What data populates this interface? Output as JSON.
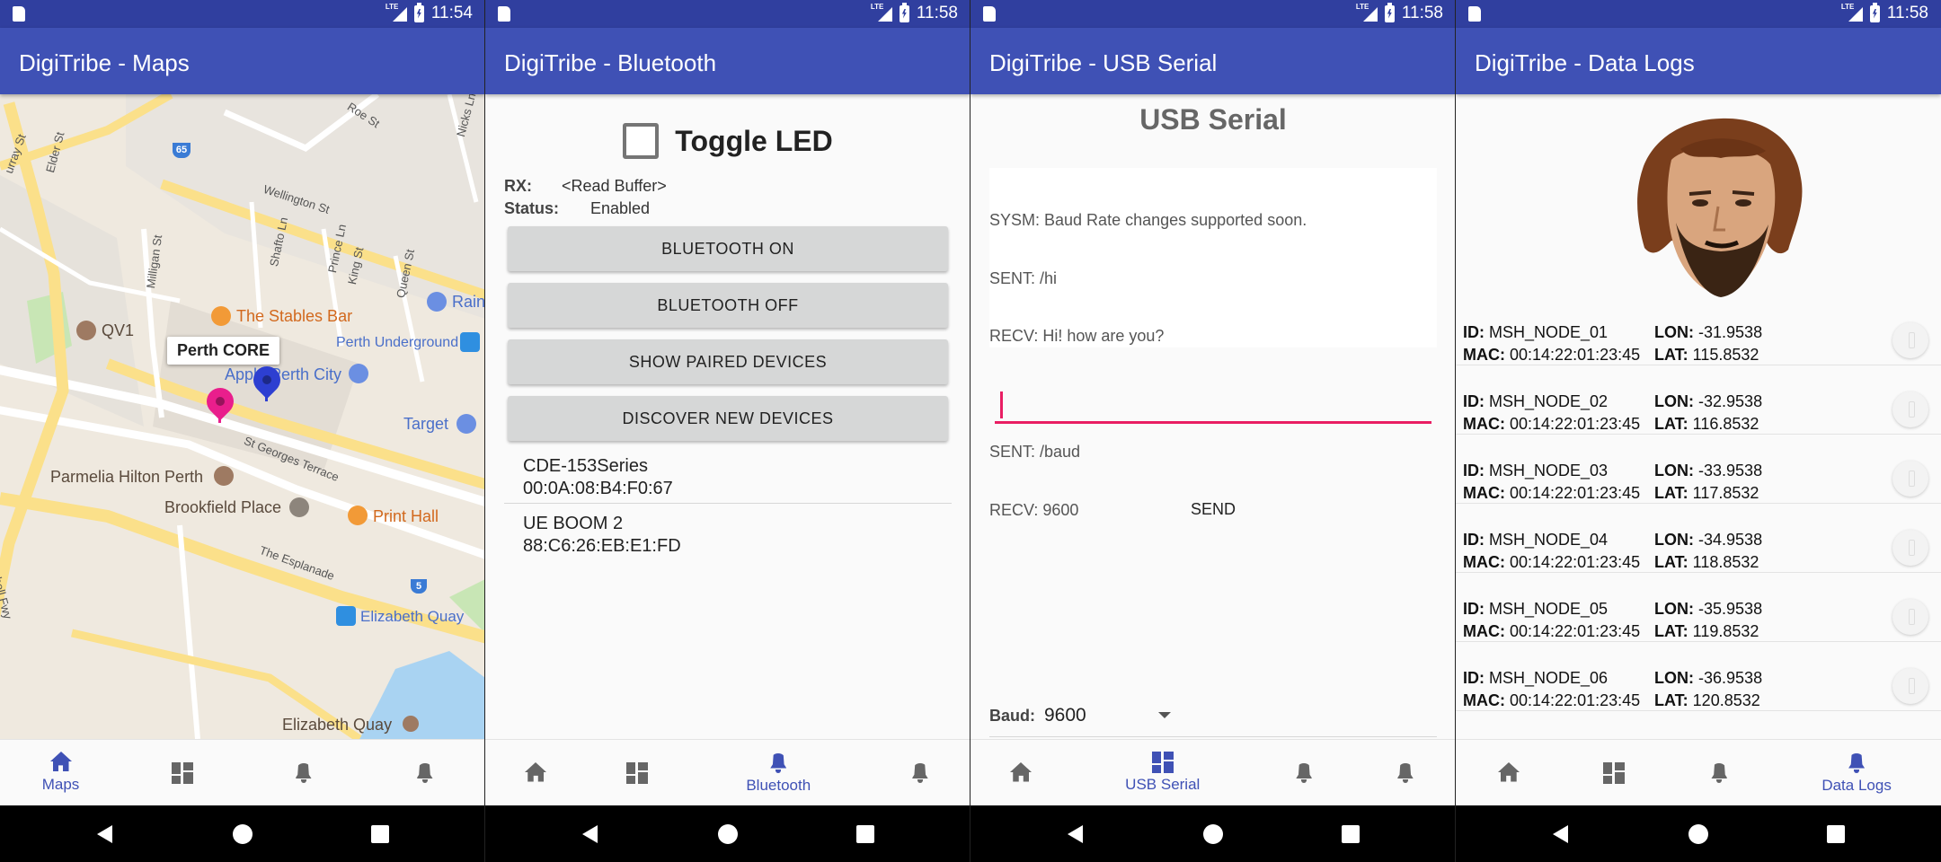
{
  "screens": {
    "maps": {
      "status_time": "11:54",
      "title": "DigiTribe - Maps",
      "map": {
        "labels": {
          "stables_bar": "The Stables Bar",
          "rain": "Rain",
          "qv1": "QV1",
          "perth_underground": "Perth Underground",
          "apple_perth_city": "Apple Perth City",
          "target": "Target",
          "parmelia_hilton": "Parmelia Hilton Perth",
          "brookfield_place": "Brookfield Place",
          "print_hall": "Print Hall",
          "elizabeth_quay_station": "Elizabeth Quay",
          "elizabeth_quay": "Elizabeth Quay"
        },
        "streets": {
          "roe_st": "Roe St",
          "nicks_ln": "Nicks Ln",
          "elder_st": "Elder St",
          "murray_st": "urray St",
          "wellington_st": "Wellington St",
          "shafto_ln": "Shafto Ln",
          "milligan_st": "Milligan St",
          "prince_ln": "Prince Ln",
          "king_st": "King St",
          "queen_st": "Queen St",
          "st_georges_terrace": "St Georges Terrace",
          "the_esplanade": "The Esplanade",
          "mitchell_fwy": "Mitchell Fwy"
        },
        "shields": {
          "route_65": "65",
          "route_5": "5"
        },
        "callout": "Perth CORE",
        "pin_colors": {
          "magenta": "#e91e8c",
          "blue": "#2d3fd1"
        }
      },
      "nav": [
        "Maps",
        "",
        "",
        ""
      ]
    },
    "bluetooth": {
      "status_time": "11:58",
      "title": "DigiTribe - Bluetooth",
      "toggle_label": "Toggle LED",
      "rx_label": "RX:",
      "rx_value": "<Read Buffer>",
      "status_label": "Status:",
      "status_value": "Enabled",
      "buttons": [
        "BLUETOOTH ON",
        "BLUETOOTH OFF",
        "SHOW PAIRED DEVICES",
        "DISCOVER NEW DEVICES"
      ],
      "devices": [
        {
          "name": "CDE-153Series",
          "mac": "00:0A:08:B4:F0:67"
        },
        {
          "name": "UE BOOM 2",
          "mac": "88:C6:26:EB:E1:FD"
        }
      ],
      "nav": [
        "",
        "",
        "Bluetooth",
        ""
      ]
    },
    "usb": {
      "status_time": "11:58",
      "title": "DigiTribe - USB Serial",
      "heading": "USB Serial",
      "log_lines": [
        "SYSM: Baud Rate changes supported soon.",
        "SENT: /hi",
        "RECV: Hi! how are you?",
        "",
        "SENT: /baud",
        "RECV: 9600"
      ],
      "input_value": "",
      "send_label": "SEND",
      "baud_label": "Baud:",
      "baud_value": "9600",
      "nav": [
        "",
        "USB Serial",
        "",
        ""
      ]
    },
    "logs": {
      "status_time": "11:58",
      "title": "DigiTribe - Data Logs",
      "labels": {
        "id": "ID:",
        "mac": "MAC:",
        "lon": "LON:",
        "lat": "LAT:"
      },
      "rows": [
        {
          "id": "MSH_NODE_01",
          "mac": "00:14:22:01:23:45",
          "lon": "-31.9538",
          "lat": "115.8532"
        },
        {
          "id": "MSH_NODE_02",
          "mac": "00:14:22:01:23:45",
          "lon": "-32.9538",
          "lat": "116.8532"
        },
        {
          "id": "MSH_NODE_03",
          "mac": "00:14:22:01:23:45",
          "lon": "-33.9538",
          "lat": "117.8532"
        },
        {
          "id": "MSH_NODE_04",
          "mac": "00:14:22:01:23:45",
          "lon": "-34.9538",
          "lat": "118.8532"
        },
        {
          "id": "MSH_NODE_05",
          "mac": "00:14:22:01:23:45",
          "lon": "-35.9538",
          "lat": "119.8532"
        },
        {
          "id": "MSH_NODE_06",
          "mac": "00:14:22:01:23:45",
          "lon": "-36.9538",
          "lat": "120.8532"
        }
      ],
      "nav": [
        "",
        "",
        "",
        "Data Logs"
      ]
    }
  },
  "colors": {
    "status_bar": "#303f9f",
    "toolbar": "#3f51b5",
    "accent": "#e91e63",
    "nav_active": "#3f51b5"
  }
}
